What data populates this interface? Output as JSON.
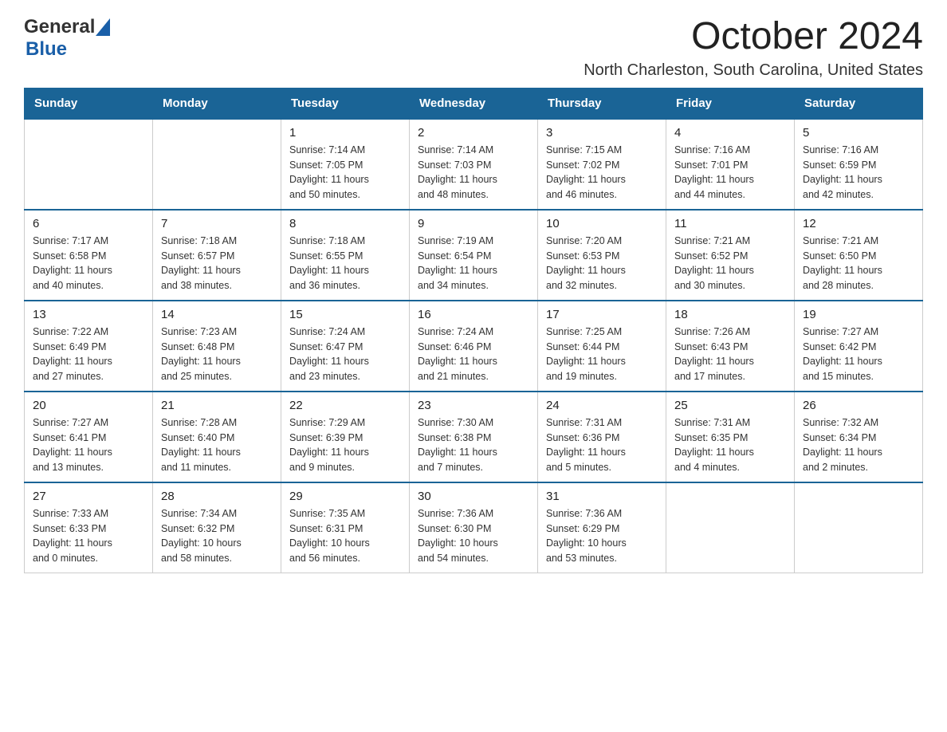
{
  "header": {
    "logo_general": "General",
    "logo_blue": "Blue",
    "month_title": "October 2024",
    "location": "North Charleston, South Carolina, United States"
  },
  "days_of_week": [
    "Sunday",
    "Monday",
    "Tuesday",
    "Wednesday",
    "Thursday",
    "Friday",
    "Saturday"
  ],
  "weeks": [
    [
      {
        "day": "",
        "info": ""
      },
      {
        "day": "",
        "info": ""
      },
      {
        "day": "1",
        "info": "Sunrise: 7:14 AM\nSunset: 7:05 PM\nDaylight: 11 hours\nand 50 minutes."
      },
      {
        "day": "2",
        "info": "Sunrise: 7:14 AM\nSunset: 7:03 PM\nDaylight: 11 hours\nand 48 minutes."
      },
      {
        "day": "3",
        "info": "Sunrise: 7:15 AM\nSunset: 7:02 PM\nDaylight: 11 hours\nand 46 minutes."
      },
      {
        "day": "4",
        "info": "Sunrise: 7:16 AM\nSunset: 7:01 PM\nDaylight: 11 hours\nand 44 minutes."
      },
      {
        "day": "5",
        "info": "Sunrise: 7:16 AM\nSunset: 6:59 PM\nDaylight: 11 hours\nand 42 minutes."
      }
    ],
    [
      {
        "day": "6",
        "info": "Sunrise: 7:17 AM\nSunset: 6:58 PM\nDaylight: 11 hours\nand 40 minutes."
      },
      {
        "day": "7",
        "info": "Sunrise: 7:18 AM\nSunset: 6:57 PM\nDaylight: 11 hours\nand 38 minutes."
      },
      {
        "day": "8",
        "info": "Sunrise: 7:18 AM\nSunset: 6:55 PM\nDaylight: 11 hours\nand 36 minutes."
      },
      {
        "day": "9",
        "info": "Sunrise: 7:19 AM\nSunset: 6:54 PM\nDaylight: 11 hours\nand 34 minutes."
      },
      {
        "day": "10",
        "info": "Sunrise: 7:20 AM\nSunset: 6:53 PM\nDaylight: 11 hours\nand 32 minutes."
      },
      {
        "day": "11",
        "info": "Sunrise: 7:21 AM\nSunset: 6:52 PM\nDaylight: 11 hours\nand 30 minutes."
      },
      {
        "day": "12",
        "info": "Sunrise: 7:21 AM\nSunset: 6:50 PM\nDaylight: 11 hours\nand 28 minutes."
      }
    ],
    [
      {
        "day": "13",
        "info": "Sunrise: 7:22 AM\nSunset: 6:49 PM\nDaylight: 11 hours\nand 27 minutes."
      },
      {
        "day": "14",
        "info": "Sunrise: 7:23 AM\nSunset: 6:48 PM\nDaylight: 11 hours\nand 25 minutes."
      },
      {
        "day": "15",
        "info": "Sunrise: 7:24 AM\nSunset: 6:47 PM\nDaylight: 11 hours\nand 23 minutes."
      },
      {
        "day": "16",
        "info": "Sunrise: 7:24 AM\nSunset: 6:46 PM\nDaylight: 11 hours\nand 21 minutes."
      },
      {
        "day": "17",
        "info": "Sunrise: 7:25 AM\nSunset: 6:44 PM\nDaylight: 11 hours\nand 19 minutes."
      },
      {
        "day": "18",
        "info": "Sunrise: 7:26 AM\nSunset: 6:43 PM\nDaylight: 11 hours\nand 17 minutes."
      },
      {
        "day": "19",
        "info": "Sunrise: 7:27 AM\nSunset: 6:42 PM\nDaylight: 11 hours\nand 15 minutes."
      }
    ],
    [
      {
        "day": "20",
        "info": "Sunrise: 7:27 AM\nSunset: 6:41 PM\nDaylight: 11 hours\nand 13 minutes."
      },
      {
        "day": "21",
        "info": "Sunrise: 7:28 AM\nSunset: 6:40 PM\nDaylight: 11 hours\nand 11 minutes."
      },
      {
        "day": "22",
        "info": "Sunrise: 7:29 AM\nSunset: 6:39 PM\nDaylight: 11 hours\nand 9 minutes."
      },
      {
        "day": "23",
        "info": "Sunrise: 7:30 AM\nSunset: 6:38 PM\nDaylight: 11 hours\nand 7 minutes."
      },
      {
        "day": "24",
        "info": "Sunrise: 7:31 AM\nSunset: 6:36 PM\nDaylight: 11 hours\nand 5 minutes."
      },
      {
        "day": "25",
        "info": "Sunrise: 7:31 AM\nSunset: 6:35 PM\nDaylight: 11 hours\nand 4 minutes."
      },
      {
        "day": "26",
        "info": "Sunrise: 7:32 AM\nSunset: 6:34 PM\nDaylight: 11 hours\nand 2 minutes."
      }
    ],
    [
      {
        "day": "27",
        "info": "Sunrise: 7:33 AM\nSunset: 6:33 PM\nDaylight: 11 hours\nand 0 minutes."
      },
      {
        "day": "28",
        "info": "Sunrise: 7:34 AM\nSunset: 6:32 PM\nDaylight: 10 hours\nand 58 minutes."
      },
      {
        "day": "29",
        "info": "Sunrise: 7:35 AM\nSunset: 6:31 PM\nDaylight: 10 hours\nand 56 minutes."
      },
      {
        "day": "30",
        "info": "Sunrise: 7:36 AM\nSunset: 6:30 PM\nDaylight: 10 hours\nand 54 minutes."
      },
      {
        "day": "31",
        "info": "Sunrise: 7:36 AM\nSunset: 6:29 PM\nDaylight: 10 hours\nand 53 minutes."
      },
      {
        "day": "",
        "info": ""
      },
      {
        "day": "",
        "info": ""
      }
    ]
  ]
}
